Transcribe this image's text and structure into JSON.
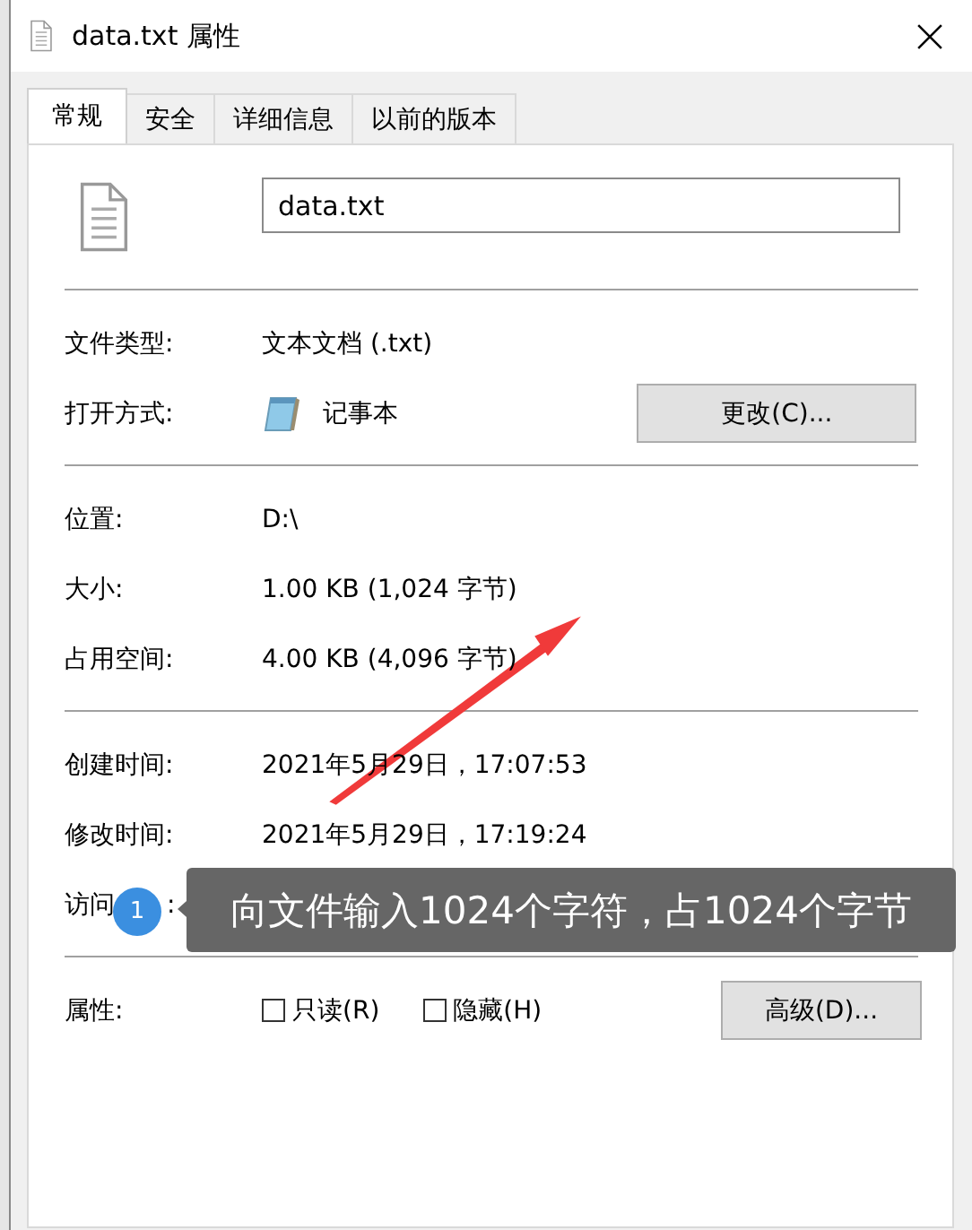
{
  "window": {
    "title": "data.txt 属性"
  },
  "tabs": [
    {
      "label": "常规",
      "selected": true
    },
    {
      "label": "安全",
      "selected": false
    },
    {
      "label": "详细信息",
      "selected": false
    },
    {
      "label": "以前的版本",
      "selected": false
    }
  ],
  "file_name": {
    "value": "data.txt"
  },
  "sections": [
    [
      {
        "kind": "text",
        "label": "文件类型:",
        "value": "文本文档 (.txt)"
      },
      {
        "kind": "app",
        "label": "打开方式:",
        "value": "记事本",
        "button": "更改(C)..."
      }
    ],
    [
      {
        "kind": "text",
        "label": "位置:",
        "value": "D:\\"
      },
      {
        "kind": "text",
        "label": "大小:",
        "value": "1.00 KB (1,024 字节)"
      },
      {
        "kind": "text",
        "label": "占用空间:",
        "value": "4.00 KB (4,096 字节)"
      }
    ],
    [
      {
        "kind": "text",
        "label": "创建时间:",
        "value": "2021年5月29日，17:07:53"
      },
      {
        "kind": "text",
        "label": "修改时间:",
        "value": "2021年5月29日，17:19:24"
      },
      {
        "kind": "covered",
        "label": "访问",
        "tail": ":"
      }
    ],
    [
      {
        "kind": "attributes",
        "label": "属性:",
        "checkboxes": [
          {
            "label": "只读(R)",
            "checked": false
          },
          {
            "label": "隐藏(H)",
            "checked": false
          }
        ],
        "button": "高级(D)..."
      }
    ]
  ],
  "annotation": {
    "badge": "1",
    "text": "向文件输入1024个字符，占1024个字节"
  }
}
